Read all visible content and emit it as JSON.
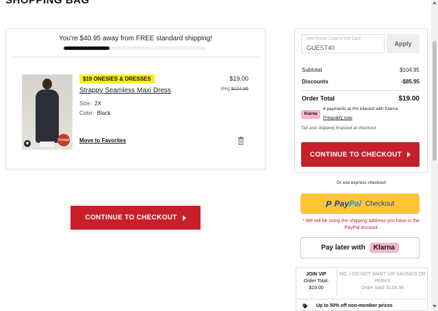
{
  "page": {
    "title": "SHOPPING BAG"
  },
  "shipping": {
    "message": "You're $40.95 away from FREE standard shipping!",
    "progress": 0.32
  },
  "item": {
    "promo_tag": "$19 ONESIES & DRESSES",
    "name": "Strappy Seamless Maxi Dress",
    "size_label": "Size:",
    "size_value": "2X",
    "color_label": "Color:",
    "color_value": "Black",
    "price": "$19.00",
    "reg_label": "Reg",
    "reg_price": "$104.95",
    "move_to_favorites": "Move to Favorites",
    "image_badge": "Savage"
  },
  "checkout_main": {
    "label": "CONTINUE TO CHECKOUT"
  },
  "summary": {
    "promo_placeholder": "Add Promo Code or Gift Card",
    "promo_value": "GUEST40",
    "apply_label": "Apply",
    "subtotal_label": "Subtotal",
    "subtotal_value": "$104.95",
    "discounts_label": "Discounts",
    "discounts_value": "-$85.95",
    "order_total_label": "Order Total",
    "order_total_value": "$19.00",
    "klarna_badge": "Klarna",
    "klarna_text": "4 payments at 0% interest with Klarna",
    "klarna_link": "Prequalify now",
    "tax_note": "Tax and shipping finalized at checkout",
    "checkout_label": "CONTINUE TO CHECKOUT"
  },
  "express": {
    "label": "Or use express checkout",
    "paypal_pay": "Pay",
    "paypal_pal": "Pal",
    "paypal_checkout": "Checkout",
    "paypal_note": "* We will be using the shipping address you have in the PayPal account",
    "klarna_pay_later": "Pay later with",
    "klarna_logo": "Klarna"
  },
  "vip": {
    "join_title": "JOIN VIP",
    "join_total_label": "Order Total:",
    "join_total_value": "$19.00",
    "no_text": "NO, I DO NOT WANT VIP SAVINGS OR PERKS",
    "no_total": "Order total: $104.95",
    "perk_text": "Up to 50% off non-member prices"
  },
  "colors": {
    "accent_red": "#c8202a",
    "paypal_yellow": "#ffc439",
    "klarna_pink": "#f4b6cb",
    "promo_yellow": "#f6f01a"
  }
}
